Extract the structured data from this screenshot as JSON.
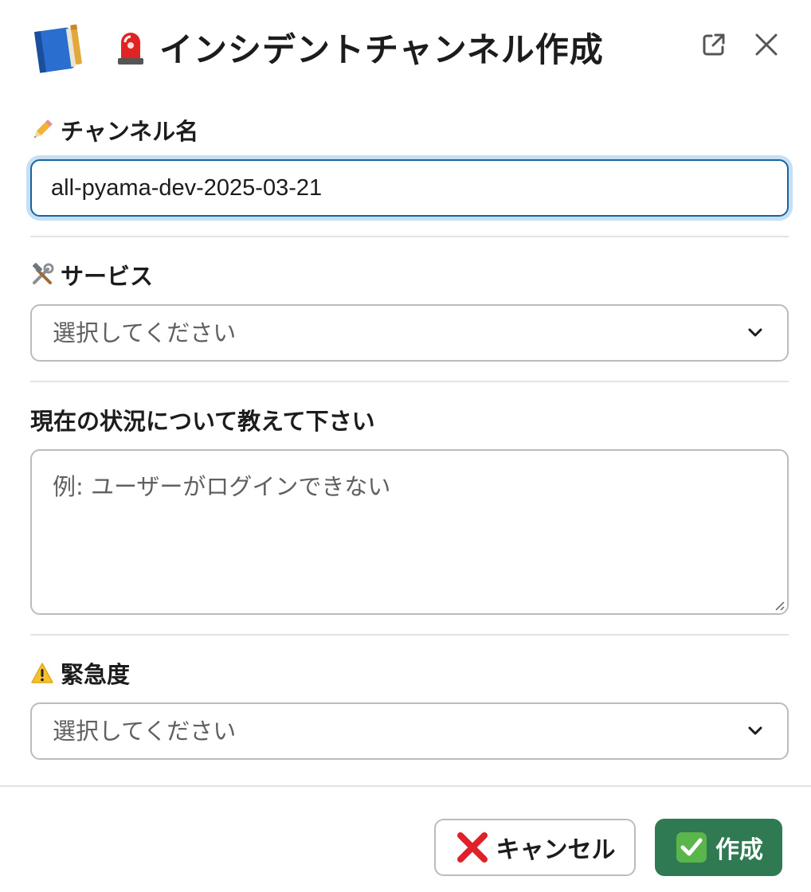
{
  "modal": {
    "title": "インシデントチャンネル作成",
    "icons": {
      "app": "blue-book-icon",
      "title": "rotating-light-icon",
      "popout": "external-link-icon",
      "close": "close-icon"
    }
  },
  "fields": {
    "channel_name": {
      "label": "チャンネル名",
      "icon": "pencil-icon",
      "value": "all-pyama-dev-2025-03-21"
    },
    "service": {
      "label": "サービス",
      "icon": "hammer-and-wrench-icon",
      "placeholder": "選択してください"
    },
    "situation": {
      "label": "現在の状況について教えて下さい",
      "placeholder": "例: ユーザーがログインできない"
    },
    "severity": {
      "label": "緊急度",
      "icon": "warning-icon",
      "placeholder": "選択してください"
    }
  },
  "buttons": {
    "cancel": {
      "label": "キャンセル",
      "icon": "cross-mark-icon"
    },
    "create": {
      "label": "作成",
      "icon": "check-mark-button-icon"
    }
  },
  "colors": {
    "primary": "#2f7a53",
    "focus": "#1264a3",
    "text": "#1d1c1d",
    "placeholder": "#616061"
  }
}
